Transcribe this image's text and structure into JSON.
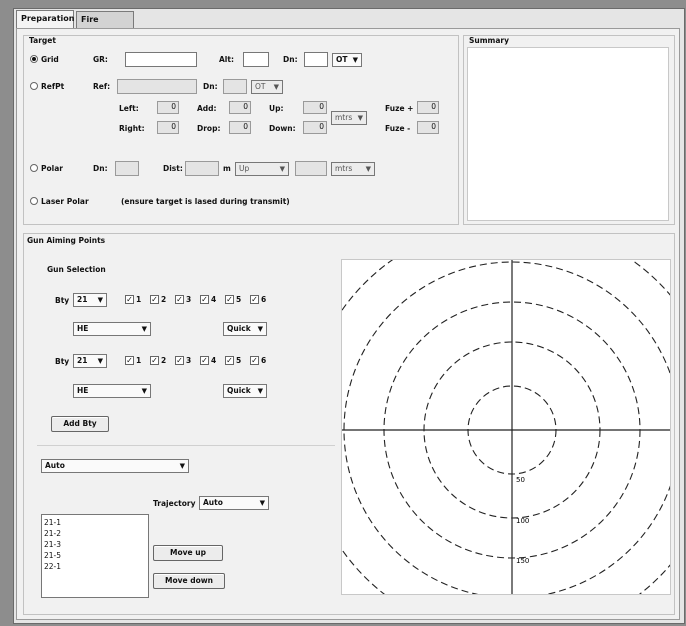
{
  "tabs": [
    "Preparation",
    "Fire Orders"
  ],
  "target": {
    "title": "Target",
    "grid": {
      "radio": "Grid",
      "gr_label": "GR:",
      "alt_label": "Alt:",
      "dn_label": "Dn:",
      "dn_unit": "OT"
    },
    "refpt": {
      "radio": "RefPt",
      "ref_label": "Ref:",
      "dn_label": "Dn:",
      "dn_unit": "OT",
      "left_label": "Left:",
      "left_value": "0",
      "add_label": "Add:",
      "add_value": "0",
      "up_label": "Up:",
      "up_value": "0",
      "right_label": "Right:",
      "right_value": "0",
      "drop_label": "Drop:",
      "drop_value": "0",
      "down_label": "Down:",
      "down_value": "0",
      "unit": "mtrs",
      "fuze_plus_label": "Fuze +",
      "fuze_plus_value": "0",
      "fuze_minus_label": "Fuze -",
      "fuze_minus_value": "0"
    },
    "polar": {
      "radio": "Polar",
      "dn_label": "Dn:",
      "dist_label": "Dist:",
      "m_label": "m",
      "dir": "Up",
      "unit": "mtrs"
    },
    "laser": {
      "radio": "Laser Polar",
      "note": "(ensure target is lased during transmit)"
    }
  },
  "summary": {
    "title": "Summary"
  },
  "gap": {
    "title": "Gun Aiming Points",
    "gun_selection": "Gun Selection",
    "bty_label": "Bty",
    "rows": [
      {
        "bty": "21",
        "ammo": "HE",
        "speed": "Quick",
        "guns": [
          "1",
          "2",
          "3",
          "4",
          "5",
          "6"
        ]
      },
      {
        "bty": "21",
        "ammo": "HE",
        "speed": "Quick",
        "guns": [
          "1",
          "2",
          "3",
          "4",
          "5",
          "6"
        ]
      }
    ],
    "add_bty": "Add Bty",
    "mode": "Auto",
    "trajectory_label": "Trajectory",
    "trajectory": "Auto",
    "list": [
      "21-1",
      "21-2",
      "21-3",
      "21-5",
      "22-1"
    ],
    "move_up": "Move up",
    "move_down": "Move down"
  },
  "plot": {
    "range_labels": [
      "50",
      "100",
      "150"
    ]
  }
}
